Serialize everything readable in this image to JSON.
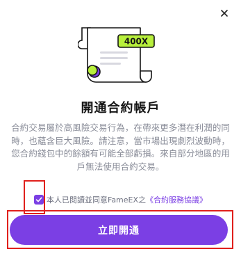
{
  "dialog": {
    "close_icon": "close-icon",
    "illustration": {
      "badge_text": "400X"
    },
    "title": "開通合約帳戶",
    "description": "合約交易屬於高風險交易行為，在帶來更多潛在利潤的同時，也蘊含巨大風險。請注意，當市場出現劇烈波動時，您合約錢包中的餘額有可能全部虧損。來自部分地區的用戶無法使用合約交易。",
    "agreement": {
      "checked": true,
      "prefix": "本人已閱讀並同意FameEX之",
      "link_text": "《合約服務協議》"
    },
    "primary_button": "立即開通"
  },
  "colors": {
    "accent": "#7b3fe4",
    "badge_bg": "#b8f03c",
    "highlight_border": "#e0201c"
  }
}
